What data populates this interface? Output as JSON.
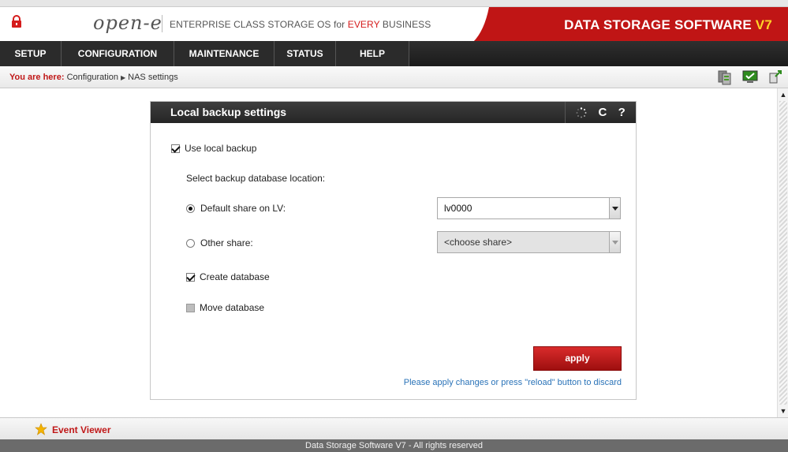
{
  "header": {
    "logo": "open-e",
    "tagline_prefix": "ENTERPRISE CLASS STORAGE OS for ",
    "tagline_highlight": "EVERY",
    "tagline_suffix": " BUSINESS",
    "brand": "DATA STORAGE SOFTWARE ",
    "brand_version": "V7"
  },
  "nav": {
    "items": [
      {
        "label": "SETUP"
      },
      {
        "label": "CONFIGURATION"
      },
      {
        "label": "MAINTENANCE"
      },
      {
        "label": "STATUS"
      },
      {
        "label": "HELP"
      }
    ]
  },
  "breadcrumb": {
    "lead": "You are here:",
    "items": [
      "Configuration",
      "NAS settings"
    ]
  },
  "panel": {
    "title": "Local backup settings",
    "tools": {
      "refresh": "C",
      "help": "?"
    },
    "use_local_backup_label": "Use local backup",
    "select_location_label": "Select backup database location:",
    "default_share_label": "Default share on LV:",
    "default_share_value": "lv0000",
    "other_share_label": "Other share:",
    "other_share_value": "<choose share>",
    "create_db_label": "Create database",
    "move_db_label": "Move database",
    "apply_label": "apply",
    "hint": "Please apply changes or press \"reload\" button to discard"
  },
  "event_viewer": {
    "label": "Event Viewer"
  },
  "footer": {
    "text": "Data Storage Software V7 - All rights reserved"
  },
  "colors": {
    "accent_red": "#d51c1c",
    "nav_bg": "#2b2b2b",
    "link_blue": "#2a73b8"
  }
}
